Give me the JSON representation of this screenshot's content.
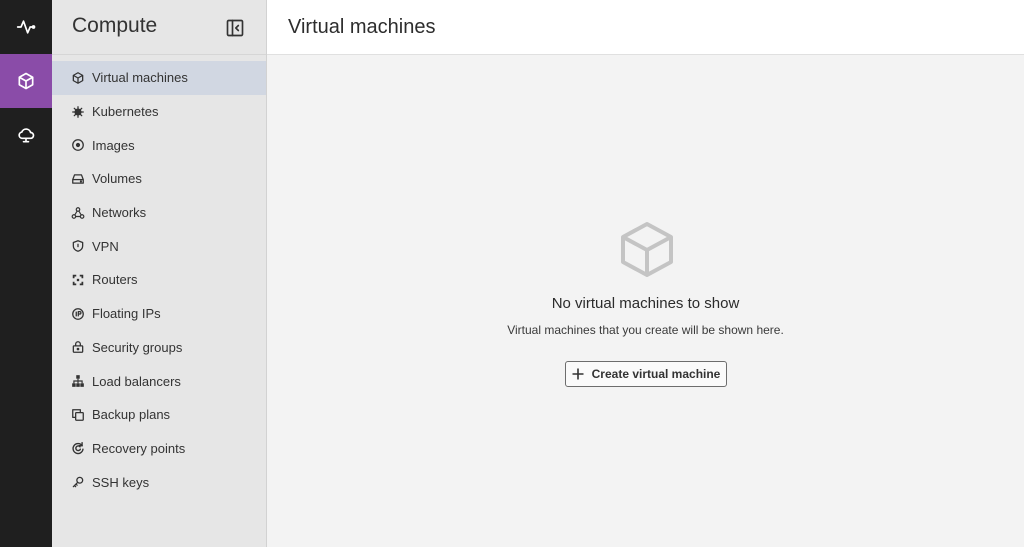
{
  "rail": {
    "items": [
      {
        "icon": "activity-icon",
        "active": false
      },
      {
        "icon": "cube-icon",
        "active": true
      },
      {
        "icon": "cloud-icon",
        "active": false
      }
    ],
    "accent": "#8a4ca8"
  },
  "sidebar": {
    "title": "Compute",
    "items": [
      {
        "label": "Virtual machines",
        "icon": "cube-icon",
        "active": true
      },
      {
        "label": "Kubernetes",
        "icon": "helm-icon"
      },
      {
        "label": "Images",
        "icon": "disc-icon"
      },
      {
        "label": "Volumes",
        "icon": "hard-drive-icon"
      },
      {
        "label": "Networks",
        "icon": "network-icon"
      },
      {
        "label": "VPN",
        "icon": "shield-icon"
      },
      {
        "label": "Routers",
        "icon": "router-icon"
      },
      {
        "label": "Floating IPs",
        "icon": "ip-icon"
      },
      {
        "label": "Security groups",
        "icon": "lock-icon"
      },
      {
        "label": "Load balancers",
        "icon": "load-balancer-icon"
      },
      {
        "label": "Backup plans",
        "icon": "copy-icon"
      },
      {
        "label": "Recovery points",
        "icon": "recovery-icon"
      },
      {
        "label": "SSH keys",
        "icon": "key-icon"
      }
    ]
  },
  "main": {
    "title": "Virtual machines",
    "empty_state": {
      "icon": "cube-icon",
      "title": "No virtual machines to show",
      "description": "Virtual machines that you create will be shown here.",
      "button_label": "Create virtual machine"
    }
  }
}
